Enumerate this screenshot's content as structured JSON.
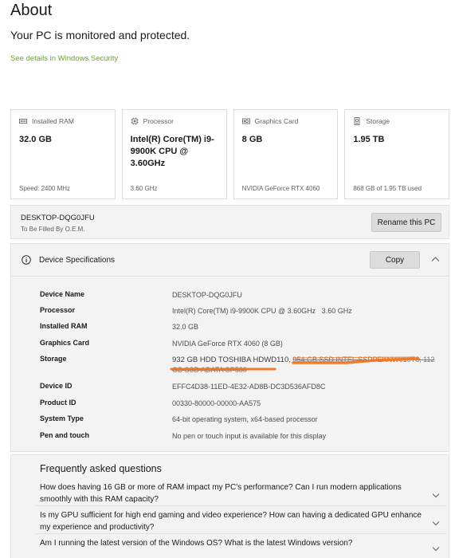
{
  "header": {
    "title": "About",
    "status": "Your PC is monitored and protected.",
    "security_link": "See details in Windows Security"
  },
  "cards": [
    {
      "label": "Installed RAM",
      "value": "32.0 GB",
      "foot": "Speed: 2400 MHz",
      "icon": "ram-icon"
    },
    {
      "label": "Processor",
      "value": "Intel(R) Core(TM) i9-9900K CPU @ 3.60GHz",
      "foot": "3.60 GHz",
      "icon": "processor-icon"
    },
    {
      "label": "Graphics Card",
      "value": "8 GB",
      "foot": "NVIDIA GeForce RTX 4060",
      "icon": "graphics-card-icon"
    },
    {
      "label": "Storage",
      "value": "1.95 TB",
      "foot": "868 GB of 1.95 TB used",
      "icon": "storage-icon"
    }
  ],
  "device": {
    "name": "DESKTOP-DQG0JFU",
    "subtitle": "To Be Filled By O.E.M.",
    "rename_label": "Rename this PC"
  },
  "specs": {
    "title": "Device Specifications",
    "copy_label": "Copy",
    "rows": [
      {
        "label": "Device Name",
        "value": "DESKTOP-DQG0JFU"
      },
      {
        "label": "Processor",
        "value": "Intel(R) Core(TM) i9-9900K CPU @ 3.60GHz   3.60 GHz"
      },
      {
        "label": "Installed RAM",
        "value": "32.0 GB"
      },
      {
        "label": "Graphics Card",
        "value": "NVIDIA GeForce RTX 4060 (8 GB)"
      },
      {
        "label": "Storage",
        "value": "932 GB HDD TOSHIBA HDWD110,",
        "value_struck": "954 GB SSD INTEL SSDPEKNW010T8, 112 GB SSD ADATA SP580"
      },
      {
        "label": "Device ID",
        "value": "EFFC4D38-11ED-4E32-AD8B-DC3D536AFD8C"
      },
      {
        "label": "Product ID",
        "value": "00330-80000-00000-AA575"
      },
      {
        "label": "System Type",
        "value": "64-bit operating system, x64-based processor"
      },
      {
        "label": "Pen and touch",
        "value": "No pen or touch input is available for this display"
      }
    ]
  },
  "faq": {
    "heading": "Frequently asked questions",
    "items": [
      "How does having 16 GB or more of RAM impact my PC's performance? Can I run modern applications smoothly with this RAM capacity?",
      "Is my GPU sufficient for high end gaming and video experience? How can having a dedicated GPU enhance my experience and productivity?",
      "Am I running the latest version of the Windows OS? What is the latest Windows version?"
    ]
  },
  "colors": {
    "link": "#6aa52a",
    "annotation": "#f07a2a",
    "panel": "#f3f3f3"
  }
}
